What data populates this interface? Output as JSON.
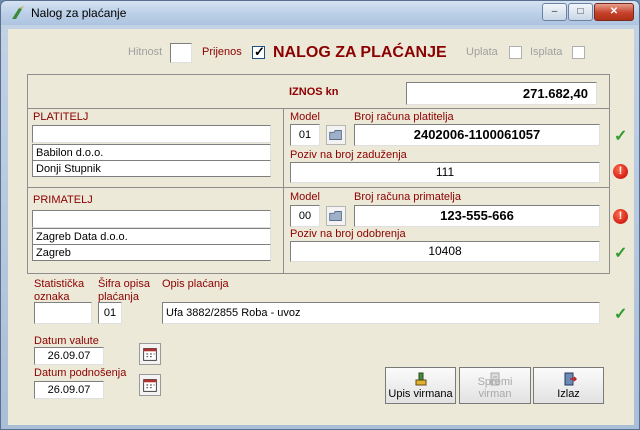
{
  "window": {
    "title": "Nalog za plaćanje",
    "minimize": "–",
    "maximize": "□",
    "close": "✕"
  },
  "header": {
    "hitnost_label": "Hitnost",
    "prijenos_label": "Prijenos",
    "prijenos_checked": true,
    "title": "NALOG ZA PLAĆANJE",
    "uplata_label": "Uplata",
    "isplata_label": "Isplata"
  },
  "amount": {
    "label": "IZNOS kn",
    "value": "271.682,40"
  },
  "payer": {
    "section_label": "PLATITELJ",
    "line1": "",
    "name": "Babilon d.o.o.",
    "city": "Donji Stupnik",
    "model_label": "Model",
    "model_value": "01",
    "account_label": "Broj računa platitelja",
    "account_value": "2402006-1100061057",
    "reference_label": "Poziv na broj zaduženja",
    "reference_value": "111"
  },
  "recipient": {
    "section_label": "PRIMATELJ",
    "line1": "",
    "name": "Zagreb Data d.o.o.",
    "city": "Zagreb",
    "model_label": "Model",
    "model_value": "00",
    "account_label": "Broj računa primatelja",
    "account_value": "123-555-666",
    "reference_label": "Poziv na broj odobrenja",
    "reference_value": "10408"
  },
  "description": {
    "stat_label_1": "Statistička",
    "stat_label_2": "oznaka",
    "stat_value": "",
    "code_label_1": "Šifra opisa",
    "code_label_2": "plaćanja",
    "code_value": "01",
    "opis_label": "Opis plaćanja",
    "opis_value": "Ufa 3882/2855 Roba - uvoz"
  },
  "dates": {
    "valuta_label": "Datum valute",
    "valuta_value": "26.09.07",
    "podnosenje_label": "Datum podnošenja",
    "podnosenje_value": "26.09.07"
  },
  "buttons": {
    "upis": "Upis virmana",
    "spremi": "Spremi virman",
    "izlaz": "Izlaz"
  },
  "validation": {
    "ok_symbol": "✓",
    "error_symbol": "!"
  },
  "colors": {
    "label_red": "#8b0000",
    "ok_green": "#2e9d2e",
    "error_red": "#c00000"
  }
}
